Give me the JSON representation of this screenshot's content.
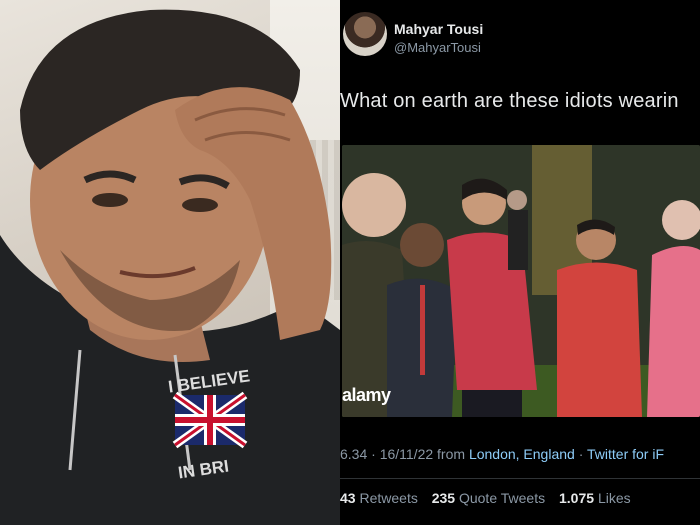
{
  "left_photo": {
    "hoodie_text": [
      "I BELIEVE",
      "IN BRI"
    ]
  },
  "tweet": {
    "display_name": "Mahyar Tousi",
    "handle": "@MahyarTousi",
    "text": "What on earth are these idiots wearin",
    "photo": {
      "watermark": "alamy"
    },
    "meta": {
      "time_date": "6.34 · 16/11/22 from ",
      "location": "London, England",
      "separator": " · ",
      "source": "Twitter for iF"
    },
    "stats": {
      "retweets_count": "43",
      "retweets_label": "Retweets",
      "quote_count": "235",
      "quote_label": "Quote Tweets",
      "likes_count": "1.075",
      "likes_label": "Likes"
    }
  }
}
